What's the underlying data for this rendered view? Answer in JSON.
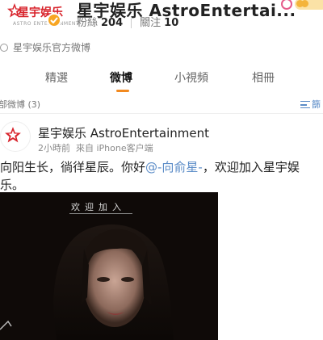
{
  "profile": {
    "logo_text": "星宇娱乐",
    "logo_subtext": "ASTRO ENTERTAINMENT",
    "name": "星宇娱乐 AstroEntertai...",
    "followers_label": "粉絲",
    "followers_count": "204",
    "following_label": "關注",
    "following_count": "10",
    "bio": "星宇娱乐官方微博"
  },
  "tabs": [
    {
      "label": "精選"
    },
    {
      "label": "微博"
    },
    {
      "label": "小視頻"
    },
    {
      "label": "相冊"
    }
  ],
  "filter": {
    "label": "部微博 (3)",
    "button_label": "篩"
  },
  "post": {
    "author": "星宇娱乐 AstroEntertainment",
    "time": "2小時前",
    "source": "來自 iPhone客户端",
    "text_before": "向阳生长，徜徉星辰。你好",
    "mention": "@-向俞星-",
    "text_after": "，欢迎加入星宇娱乐。",
    "image_caption": "欢迎加入"
  },
  "colors": {
    "accent_orange": "#f28a20",
    "brand_red": "#d8242c",
    "link_blue": "#5a8bc7"
  }
}
